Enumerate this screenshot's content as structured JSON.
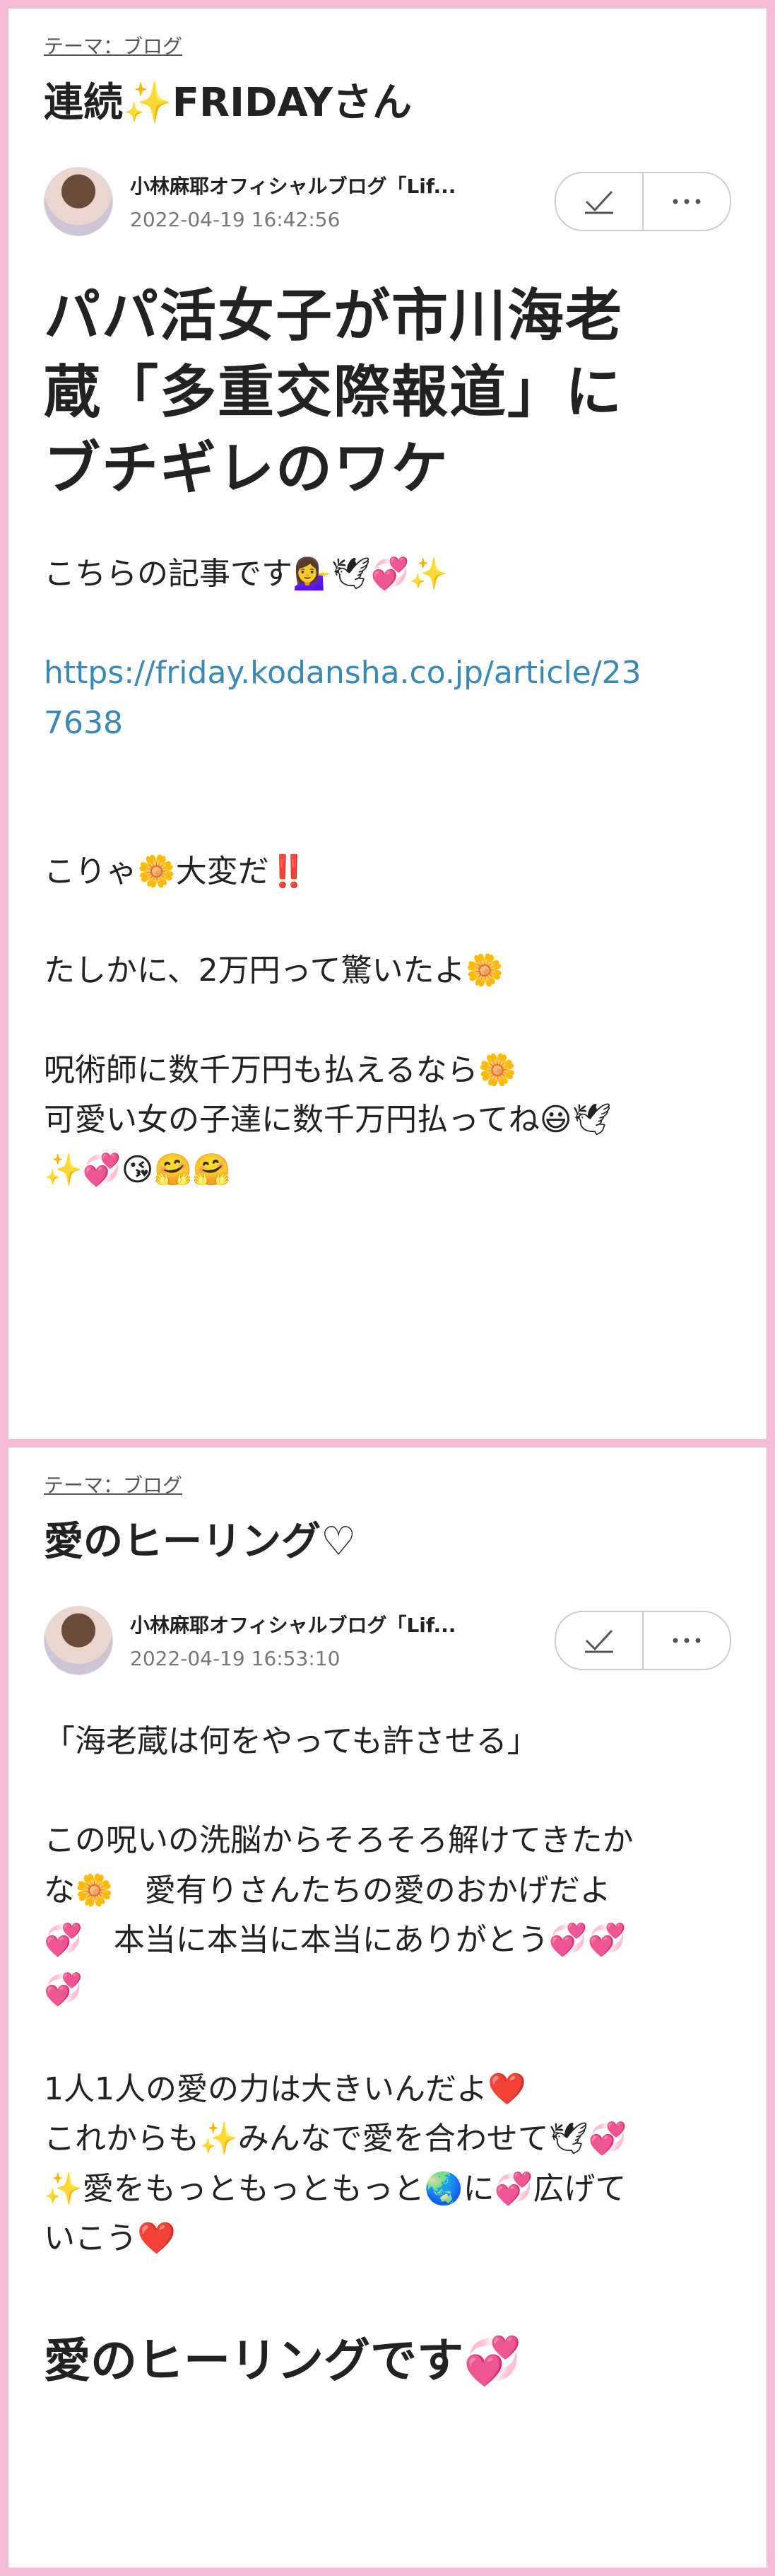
{
  "post1": {
    "theme_link": "テーマ：ブログ",
    "title": "連続✨FRIDAYさん",
    "blog_name": "小林麻耶オフィシャルブログ「Lif...",
    "date": "2022-04-19 16:42:56",
    "headline_lines": [
      "パパ活女子が市川海老",
      "蔵「多重交際報道」に",
      "ブチギレのワケ"
    ],
    "lines": {
      "l1": "こちらの記事です💁‍♀️🕊💞✨",
      "link1": "https://friday.kodansha.co.jp/article/23",
      "link2": "7638",
      "l2": "こりゃ🌼大変だ‼️",
      "l3": "たしかに、2万円って驚いたよ🌼",
      "l4": "呪術師に数千万円も払えるなら🌼",
      "l5": "可愛い女の子達に数千万円払ってね😃🕊",
      "l6": "✨💞😘🤗🤗"
    }
  },
  "post2": {
    "theme_link": "テーマ：ブログ",
    "title": "愛のヒーリング♡",
    "blog_name": "小林麻耶オフィシャルブログ「Lif...",
    "date": "2022-04-19 16:53:10",
    "lines": {
      "l1": "「海老蔵は何をやっても許させる」",
      "l2": "この呪いの洗脳からそろそろ解けてきたか",
      "l3": "な🌼　愛有りさんたちの愛のおかげだよ",
      "l4": "💞　本当に本当に本当にありがとう💞💞",
      "l5": "💞",
      "l6": "1人1人の愛の力は大きいんだよ❤️",
      "l7": "これからも✨みんなで愛を合わせて🕊💞",
      "l8": "✨愛をもっともっともっと🌏に💞広げて",
      "l9": "いこう❤️"
    },
    "sub_heading": "愛のヒーリングです💞"
  },
  "icons": {
    "check": "check-icon",
    "more": "more-horizontal-icon"
  },
  "colors": {
    "frame": "#f5bcd6",
    "link": "#3b88b5"
  }
}
